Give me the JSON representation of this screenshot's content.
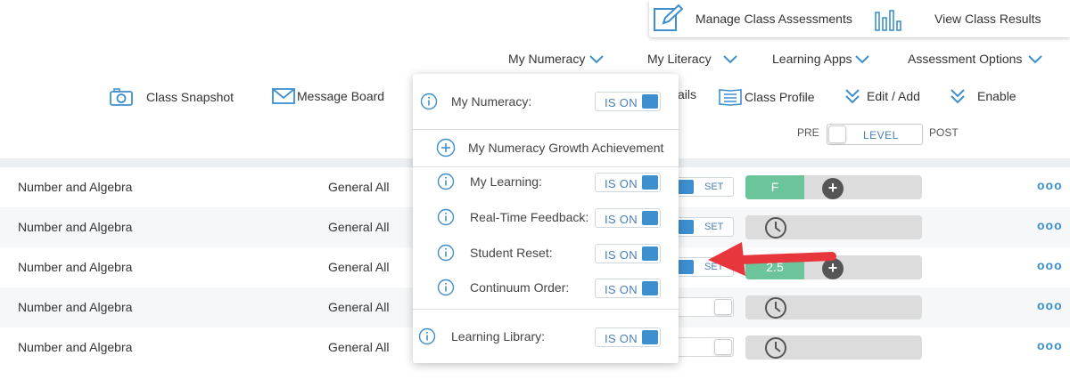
{
  "assessments": {
    "manage_label": "Manage Class Assessments",
    "results_label": "View Class Results"
  },
  "nav": [
    {
      "label": "My Numeracy"
    },
    {
      "label": "My Literacy"
    },
    {
      "label": "Learning Apps"
    },
    {
      "label": "Assessment Options"
    }
  ],
  "toolbar": {
    "snapshot": "Class Snapshot",
    "message_board": "Message Board",
    "details_fragment": "ails",
    "class_profile": "Class Profile",
    "edit_add": "Edit / Add",
    "enable": "Enable"
  },
  "level_toggle": {
    "pre": "PRE",
    "level": "LEVEL",
    "post": "POST"
  },
  "rows": [
    {
      "strand": "Number and Algebra",
      "group": "General All",
      "set_label": "SET",
      "state": "set",
      "result": "F"
    },
    {
      "strand": "Number and Algebra",
      "group": "General All",
      "set_label": "SET",
      "state": "set",
      "result": ""
    },
    {
      "strand": "Number and Algebra",
      "group": "General All",
      "set_label": "SET",
      "state": "set",
      "result": "2.5"
    },
    {
      "strand": "Number and Algebra",
      "group": "General All",
      "set_label": "",
      "state": "off",
      "result": ""
    },
    {
      "strand": "Number and Algebra",
      "group": "General All",
      "set_label": "",
      "state": "off",
      "result": ""
    }
  ],
  "row_menu": "ooo",
  "popover": {
    "header": {
      "label": "My Numeracy:",
      "toggle": "IS ON"
    },
    "growth": "My Numeracy Growth Achievement",
    "items": [
      {
        "label": "My Learning:",
        "toggle": "IS ON"
      },
      {
        "label": "Real-Time Feedback:",
        "toggle": "IS ON"
      },
      {
        "label": "Student Reset:",
        "toggle": "IS ON"
      },
      {
        "label": "Continuum Order:",
        "toggle": "IS ON"
      }
    ],
    "footer": {
      "label": "Learning Library:",
      "toggle": "IS ON"
    }
  },
  "colors": {
    "accent": "#3d8fd0",
    "result_green": "#6cc49a",
    "arrow": "#e8363d"
  }
}
